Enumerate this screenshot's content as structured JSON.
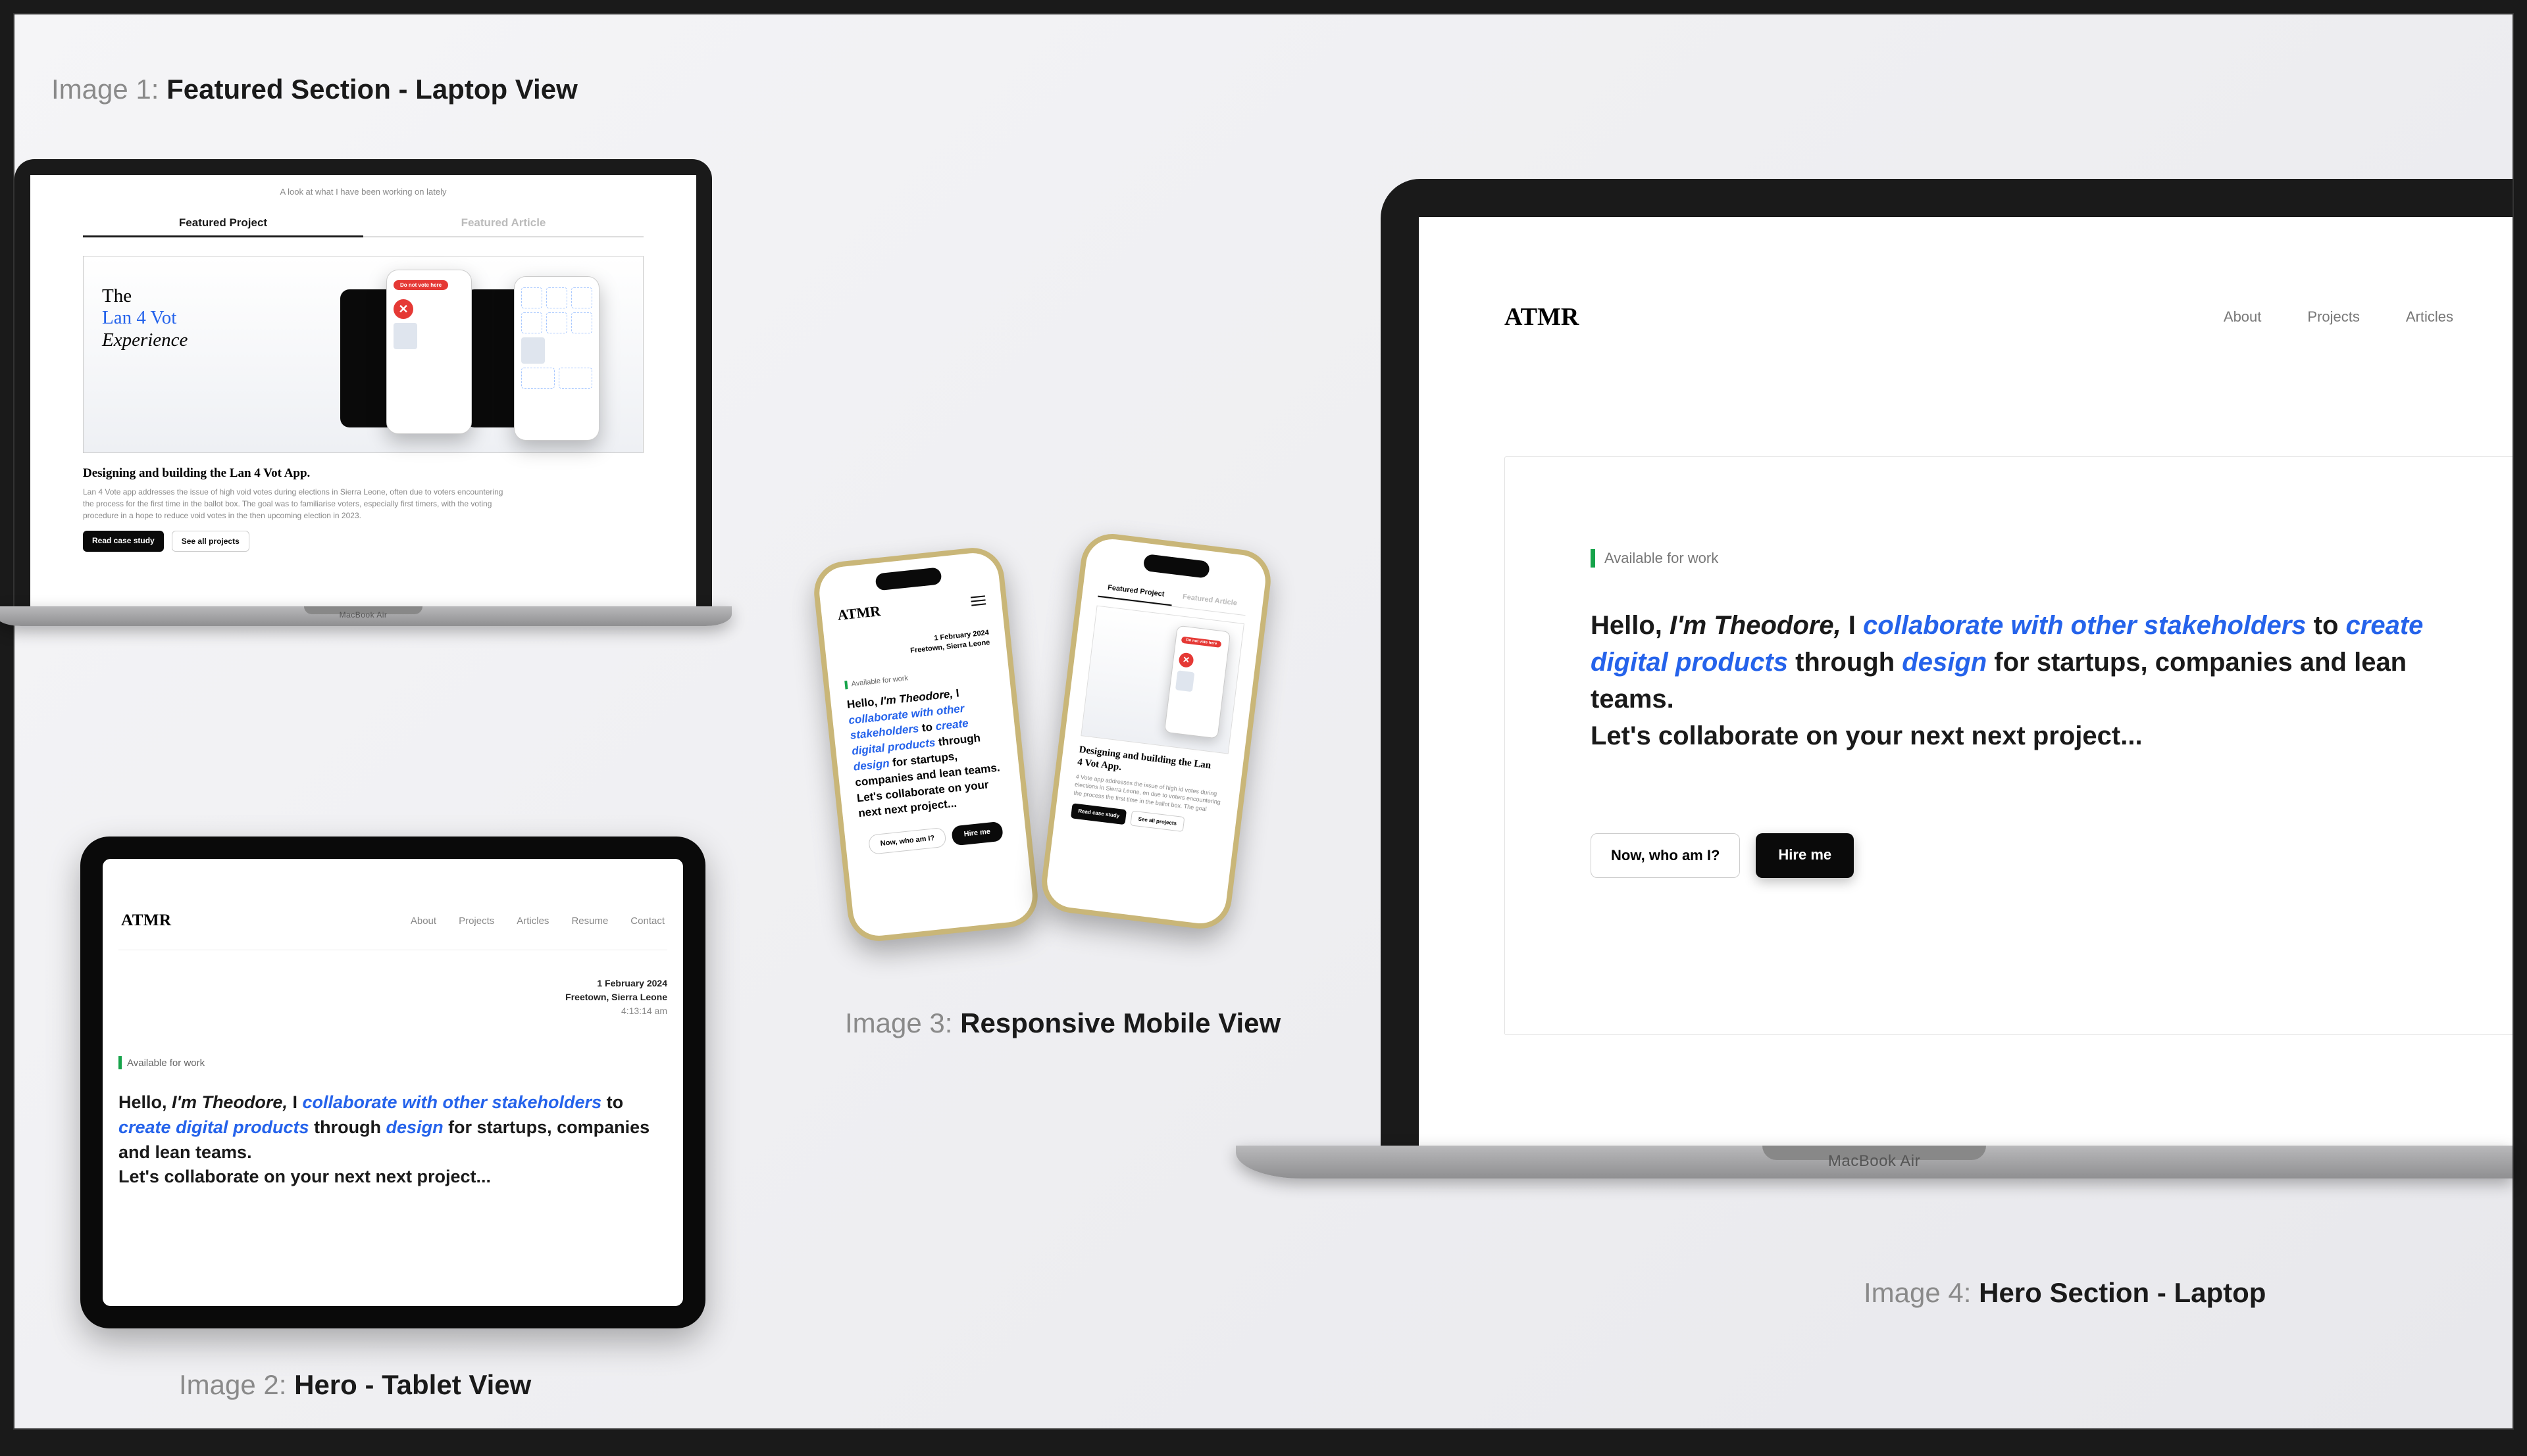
{
  "captions": {
    "img1_prefix": "Image 1: ",
    "img1_bold": "Featured Section - Laptop View",
    "img2_prefix": "Image 2:  ",
    "img2_bold": "Hero - Tablet View",
    "img3_prefix": "Image 3: ",
    "img3_bold": "Responsive Mobile View",
    "img4_prefix": "Image 4: ",
    "img4_bold": "Hero Section - Laptop"
  },
  "brand": "ATMR",
  "macbook_label": "MacBook Air",
  "nav": {
    "about": "About",
    "projects": "Projects",
    "articles": "Articles",
    "resume": "Resume",
    "contact": "Contact"
  },
  "featured": {
    "subtitle": "A look at what I have been working on lately",
    "tab_project": "Featured Project",
    "tab_article": "Featured Article",
    "frame_line1": "The",
    "frame_line2": "Lan 4 Vot",
    "frame_line3": "Experience",
    "warn": "Do not vote here",
    "x": "✕",
    "title": "Designing and building the Lan 4 Vot App.",
    "desc": "Lan 4 Vote app addresses the issue of high void votes during elections in Sierra Leone, often due to voters encountering the process for the first time in the ballot box. The goal was to familiarise voters, especially first timers, with the voting procedure in a hope to reduce void votes in the then upcoming election in 2023.",
    "btn_read": "Read case study",
    "btn_all": "See all projects"
  },
  "tablet": {
    "date": "1 February 2024",
    "location": "Freetown, Sierra Leone",
    "time": "4:13:14 am"
  },
  "available": "Available for work",
  "hero": {
    "p1": "Hello, ",
    "p2": "I'm Theodore,",
    "p3": " I ",
    "p4": "collaborate with other stakeholders",
    "p5": " to ",
    "p6": "create digital products",
    "p7": " through ",
    "p8": "design",
    "p9": " for startups, companies and lean teams.",
    "p10": "Let's collaborate on your next next project..."
  },
  "buttons": {
    "who": "Now, who am I?",
    "hire": "Hire me"
  },
  "mobile2": {
    "title_l1": "Designing and building the Lan",
    "title_l2": "4 Vot App.",
    "desc": "4 Vote app addresses the issue of high id votes during elections in Sierra Leone, en due to voters encountering the process the first time in the ballot box. The goal",
    "btn_read": "Read case study",
    "btn_all": "See all projects"
  }
}
